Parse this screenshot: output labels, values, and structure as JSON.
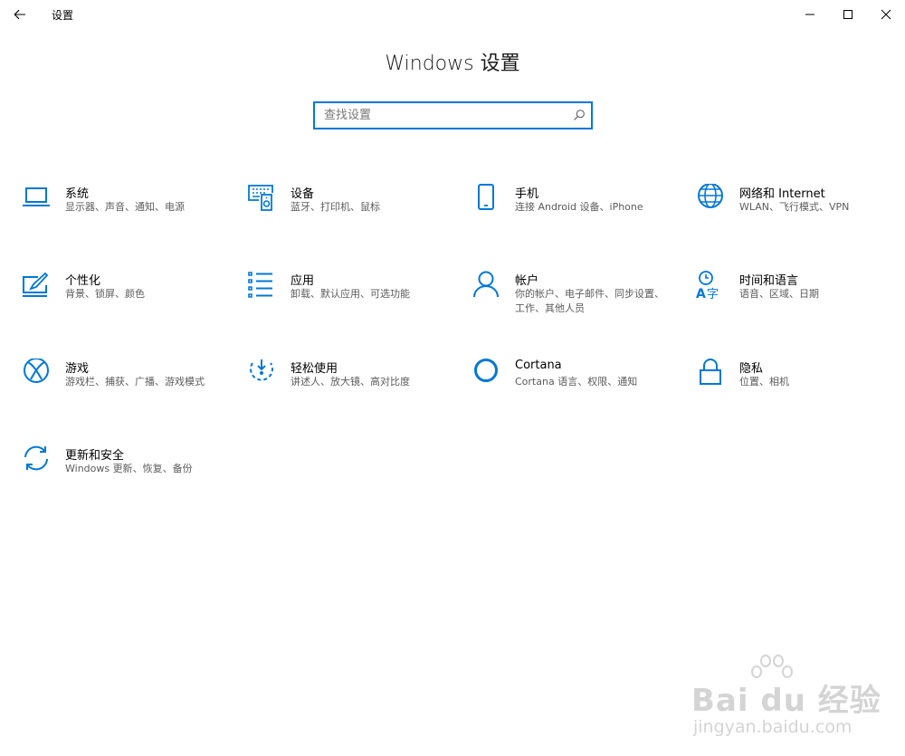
{
  "window": {
    "title": "设置",
    "back_icon": "arrow-left-icon",
    "minimize_icon": "minimize-icon",
    "maximize_icon": "maximize-icon",
    "close_icon": "close-icon"
  },
  "header": {
    "title": "Windows 设置"
  },
  "search": {
    "placeholder": "查找设置",
    "value": "",
    "icon": "search-icon"
  },
  "accent_color": "#0078d7",
  "tiles": [
    {
      "title": "系统",
      "desc": "显示器、声音、通知、电源",
      "icon": "laptop-icon"
    },
    {
      "title": "设备",
      "desc": "蓝牙、打印机、鼠标",
      "icon": "devices-icon"
    },
    {
      "title": "手机",
      "desc": "连接 Android 设备、iPhone",
      "icon": "phone-icon"
    },
    {
      "title": "网络和 Internet",
      "desc": "WLAN、飞行模式、VPN",
      "icon": "globe-icon"
    },
    {
      "title": "个性化",
      "desc": "背景、锁屏、颜色",
      "icon": "personalization-icon"
    },
    {
      "title": "应用",
      "desc": "卸载、默认应用、可选功能",
      "icon": "apps-list-icon"
    },
    {
      "title": "帐户",
      "desc": "你的帐户、电子邮件、同步设置、工作、其他人员",
      "icon": "person-icon"
    },
    {
      "title": "时间和语言",
      "desc": "语音、区域、日期",
      "icon": "time-language-icon"
    },
    {
      "title": "游戏",
      "desc": "游戏栏、捕获、广播、游戏模式",
      "icon": "xbox-icon"
    },
    {
      "title": "轻松使用",
      "desc": "讲述人、放大镜、高对比度",
      "icon": "ease-of-access-icon"
    },
    {
      "title": "Cortana",
      "desc": "Cortana 语言、权限、通知",
      "icon": "cortana-icon"
    },
    {
      "title": "隐私",
      "desc": "位置、相机",
      "icon": "lock-icon"
    },
    {
      "title": "更新和安全",
      "desc": "Windows 更新、恢复、备份",
      "icon": "update-sync-icon"
    }
  ],
  "watermark": {
    "brand": "Bai du 经验",
    "url": "jingyan.baidu.com"
  }
}
